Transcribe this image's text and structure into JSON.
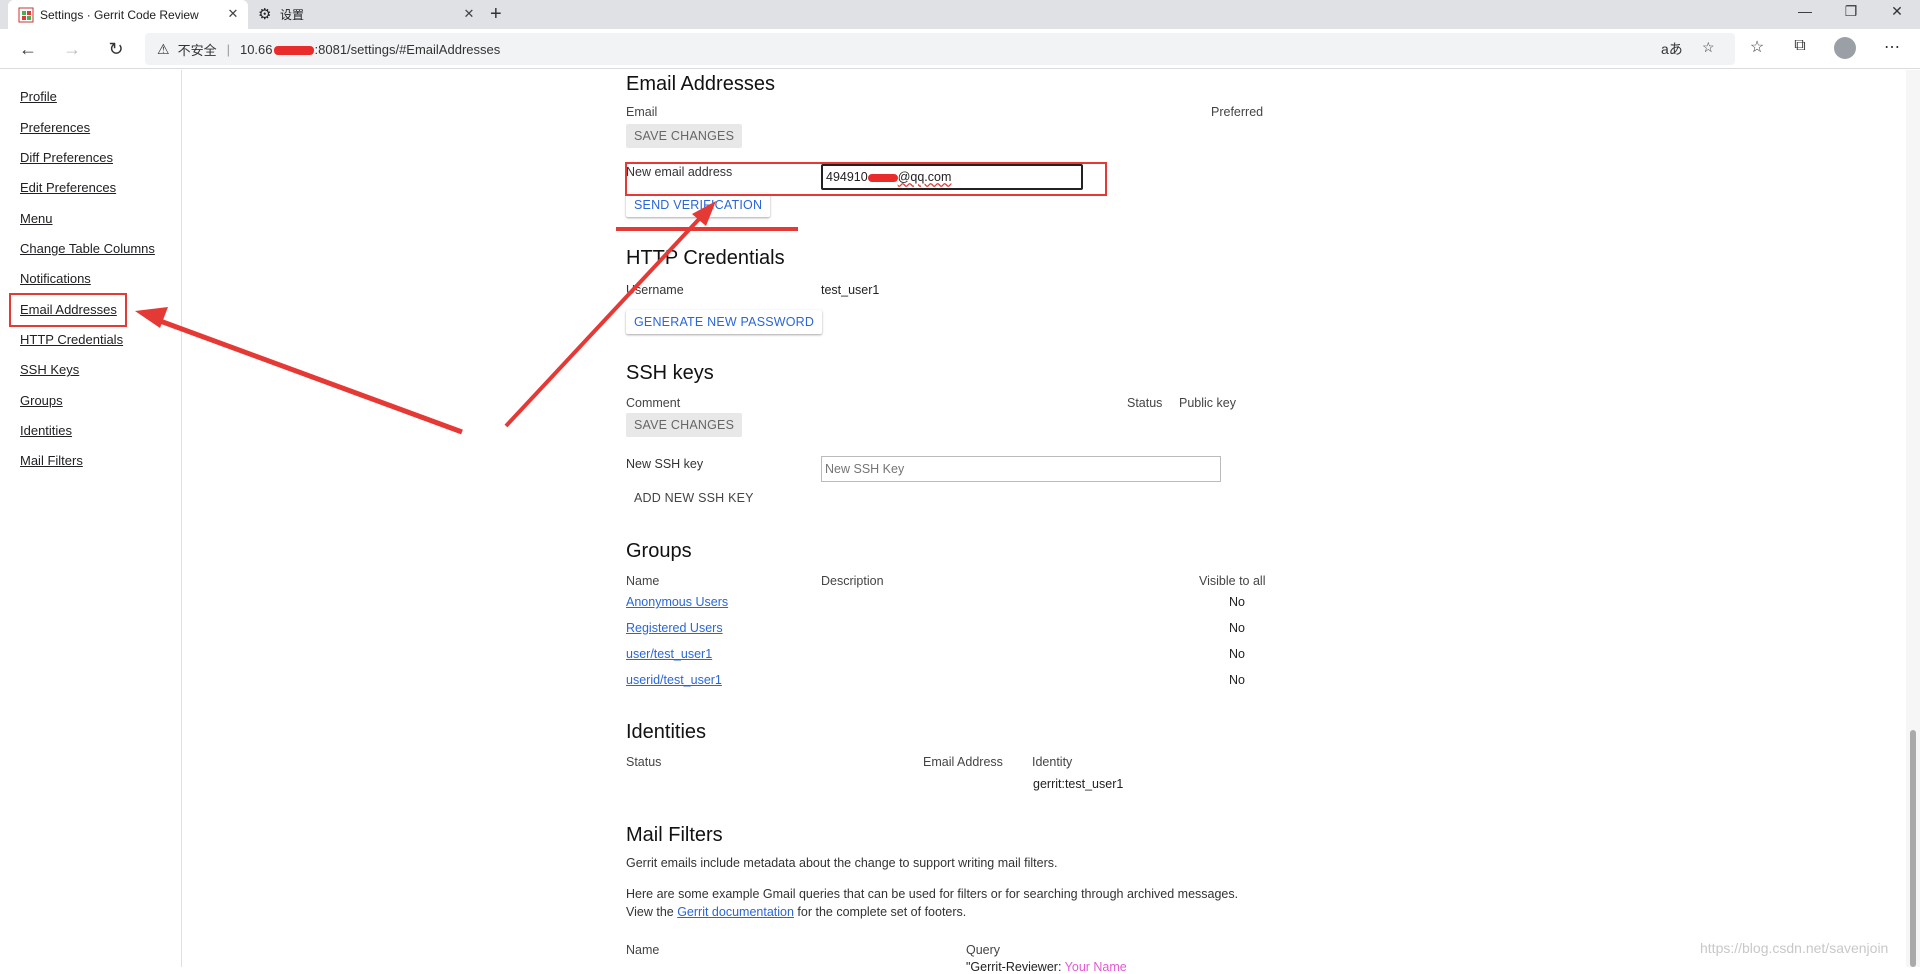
{
  "browser": {
    "tabs": [
      {
        "title": "Settings · Gerrit Code Review",
        "active": true
      },
      {
        "title": "设置",
        "active": false
      }
    ],
    "address": {
      "insecure_label": "不安全",
      "url_prefix": "10.66",
      "url_suffix": ":8081/settings/#EmailAddresses"
    }
  },
  "sidebar": {
    "items": [
      {
        "label": "Profile"
      },
      {
        "label": "Preferences"
      },
      {
        "label": "Diff Preferences"
      },
      {
        "label": "Edit Preferences"
      },
      {
        "label": "Menu"
      },
      {
        "label": "Change Table Columns"
      },
      {
        "label": "Notifications"
      },
      {
        "label": "Email Addresses"
      },
      {
        "label": "HTTP Credentials"
      },
      {
        "label": "SSH Keys"
      },
      {
        "label": "Groups"
      },
      {
        "label": "Identities"
      },
      {
        "label": "Mail Filters"
      }
    ]
  },
  "email": {
    "title": "Email Addresses",
    "col_email": "Email",
    "col_preferred": "Preferred",
    "save_label": "SAVE CHANGES",
    "new_label": "New email address",
    "new_value_prefix": "494910",
    "new_value_suffix": "@qq.com",
    "send_label": "SEND VERIFICATION"
  },
  "http": {
    "title": "HTTP Credentials",
    "username_label": "Username",
    "username_value": "test_user1",
    "generate_label": "GENERATE NEW PASSWORD"
  },
  "ssh": {
    "title": "SSH keys",
    "col_comment": "Comment",
    "col_status": "Status",
    "col_public_key": "Public key",
    "save_label": "SAVE CHANGES",
    "new_label": "New SSH key",
    "new_placeholder": "New SSH Key",
    "add_label": "ADD NEW SSH KEY"
  },
  "groups": {
    "title": "Groups",
    "col_name": "Name",
    "col_description": "Description",
    "col_visible": "Visible to all",
    "rows": [
      {
        "name": "Anonymous Users",
        "visible": "No"
      },
      {
        "name": "Registered Users",
        "visible": "No"
      },
      {
        "name": "user/test_user1",
        "visible": "No"
      },
      {
        "name": "userid/test_user1",
        "visible": "No"
      }
    ]
  },
  "identities": {
    "title": "Identities",
    "col_status": "Status",
    "col_email": "Email Address",
    "col_identity": "Identity",
    "rows": [
      {
        "identity": "gerrit:test_user1"
      }
    ]
  },
  "mail_filters": {
    "title": "Mail Filters",
    "intro": "Gerrit emails include metadata about the change to support writing mail filters.",
    "para_line1": "Here are some example Gmail queries that can be used for filters or for searching through archived messages.",
    "para_view": "View the",
    "doc_link": "Gerrit documentation",
    "para_end": "for the complete set of footers.",
    "col_name": "Name",
    "col_query": "Query",
    "query_prefix": "\"Gerrit-Reviewer: ",
    "query_highlight": "Your Name"
  },
  "watermark": "https://blog.csdn.net/savenjoin",
  "colors": {
    "annotation": "#e53935",
    "link": "#2a66d9",
    "redaction": "#e82c2c"
  }
}
